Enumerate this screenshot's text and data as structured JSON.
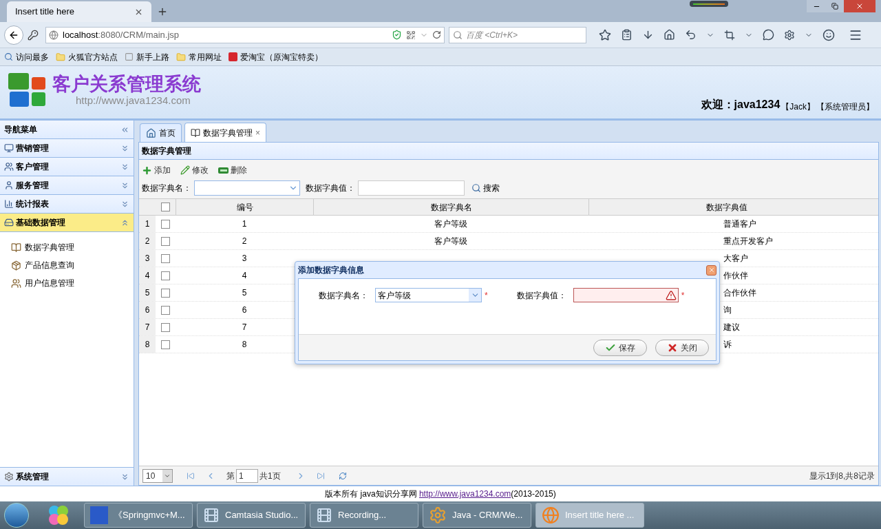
{
  "browser": {
    "tab_title": "Insert title here",
    "url_host": "localhost",
    "url_rest": ":8080/CRM/main.jsp",
    "search_placeholder": "百度 <Ctrl+K>",
    "bookmarks": [
      "访问最多",
      "火狐官方站点",
      "新手上路",
      "常用网址",
      "爱淘宝（原淘宝特卖）"
    ]
  },
  "header": {
    "title": "客户关系管理系统",
    "subtitle": "http://www.java1234.com",
    "welcome": "欢迎：java1234",
    "user": "【Jack】",
    "role": "【系统管理员】"
  },
  "sidebar": {
    "title": "导航菜单",
    "sections": [
      {
        "label": "营销管理",
        "expanded": false
      },
      {
        "label": "客户管理",
        "expanded": false
      },
      {
        "label": "服务管理",
        "expanded": false
      },
      {
        "label": "统计报表",
        "expanded": false
      },
      {
        "label": "基础数据管理",
        "expanded": true,
        "items": [
          "数据字典管理",
          "产品信息查询",
          "用户信息管理"
        ]
      }
    ],
    "bottom_section": {
      "label": "系统管理",
      "expanded": false
    }
  },
  "tabs": [
    {
      "label": "首页",
      "selected": false
    },
    {
      "label": "数据字典管理",
      "selected": true,
      "close": "×"
    }
  ],
  "panel": {
    "title": "数据字典管理",
    "toolbar": [
      "添加",
      "修改",
      "删除"
    ],
    "filter_name_label": "数据字典名：",
    "filter_value_label": "数据字典值：",
    "search": "搜索"
  },
  "table": {
    "select_all_checked": false,
    "columns": [
      "编号",
      "数据字典名",
      "数据字典值"
    ],
    "rows": [
      {
        "num": "1",
        "checked": false,
        "id": "1",
        "name": "客户等级",
        "value": "普通客户"
      },
      {
        "num": "2",
        "checked": false,
        "id": "2",
        "name": "客户等级",
        "value": "重点开发客户"
      },
      {
        "num": "3",
        "checked": false,
        "id": "3",
        "value": "大客户"
      },
      {
        "num": "4",
        "checked": false,
        "id": "4",
        "value": "作伙伴"
      },
      {
        "num": "5",
        "checked": false,
        "id": "5",
        "value": "合作伙伴"
      },
      {
        "num": "6",
        "checked": false,
        "id": "6",
        "value": "询"
      },
      {
        "num": "7",
        "checked": false,
        "id": "7",
        "value": "建议"
      },
      {
        "num": "8",
        "checked": false,
        "id": "8",
        "value": "诉"
      }
    ]
  },
  "pagination": {
    "page_size": "10",
    "page_prefix": "第",
    "page": "1",
    "page_total": "共1页",
    "summary": "显示1到8,共8记录"
  },
  "footer": {
    "text": "版本所有 java知识分享网 ",
    "link": "http://www.java1234.com",
    "tail": "(2013-2015)"
  },
  "dialog": {
    "title": "添加数据字典信息",
    "required_mark": "*",
    "fields": [
      {
        "kind": "select",
        "label": "数据字典名：",
        "value": "客户等级",
        "invalid": false
      },
      {
        "kind": "text",
        "label": "数据字典值：",
        "invalid": true
      }
    ],
    "buttons": [
      {
        "kind": "save",
        "label": "保存"
      },
      {
        "kind": "close",
        "label": "关闭"
      }
    ]
  },
  "taskbar": {
    "tasks": [
      {
        "label": "《Springmvc+M...",
        "selected": false
      },
      {
        "label": "Camtasia Studio...",
        "selected": false
      },
      {
        "label": "Recording...",
        "selected": false
      },
      {
        "label": "Java - CRM/We...",
        "selected": false
      },
      {
        "label": "Insert title here ...",
        "selected": true
      }
    ]
  }
}
